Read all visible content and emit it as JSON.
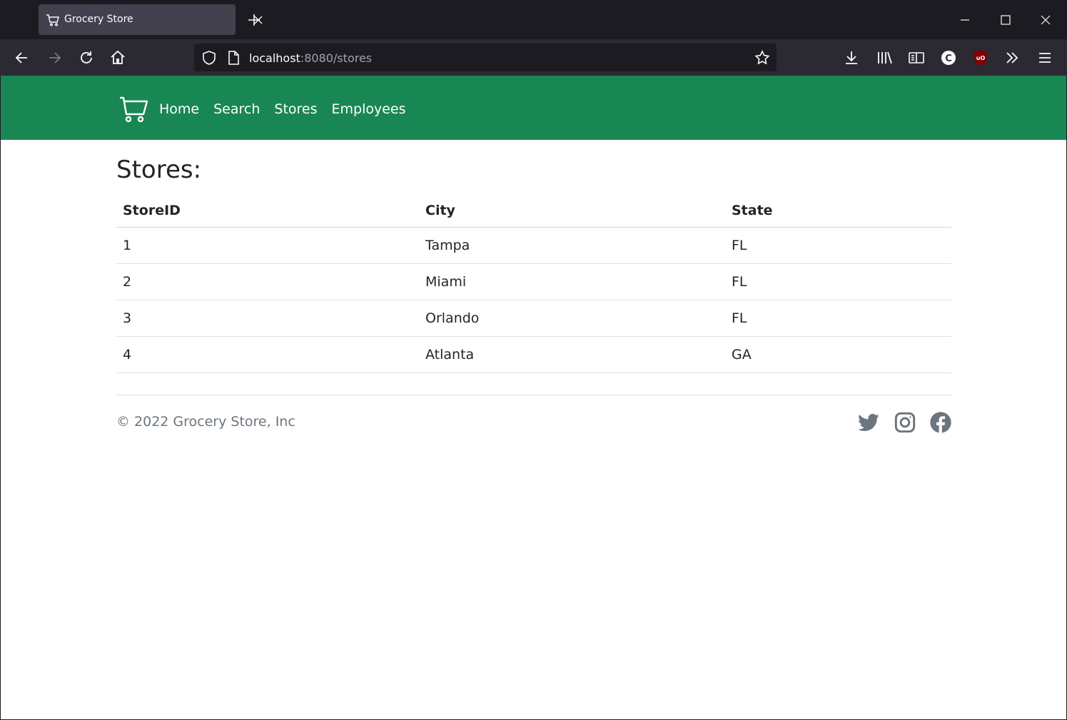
{
  "browser": {
    "tab_title": "Grocery Store",
    "url_host": "localhost",
    "url_path": ":8080/stores",
    "icons": [
      "shopping-cart-icon",
      "close-icon",
      "plus-icon",
      "minimize-icon",
      "maximize-icon",
      "window-close-icon",
      "back-icon",
      "forward-icon",
      "reload-icon",
      "home-icon",
      "shield-icon",
      "page-icon",
      "bookmark-star-icon",
      "download-icon",
      "library-icon",
      "reader-view-icon",
      "extension-c-icon",
      "ublock-icon",
      "overflow-chevrons-icon",
      "menu-icon"
    ]
  },
  "header": {
    "brand_color": "#198754",
    "nav": [
      {
        "label": "Home"
      },
      {
        "label": "Search"
      },
      {
        "label": "Stores"
      },
      {
        "label": "Employees"
      }
    ]
  },
  "main": {
    "title": "Stores:",
    "table": {
      "columns": [
        "StoreID",
        "City",
        "State"
      ],
      "rows": [
        [
          "1",
          "Tampa",
          "FL"
        ],
        [
          "2",
          "Miami",
          "FL"
        ],
        [
          "3",
          "Orlando",
          "FL"
        ],
        [
          "4",
          "Atlanta",
          "GA"
        ]
      ]
    }
  },
  "footer": {
    "copyright": "© 2022 Grocery Store, Inc",
    "social": [
      "twitter-icon",
      "instagram-icon",
      "facebook-icon"
    ]
  }
}
